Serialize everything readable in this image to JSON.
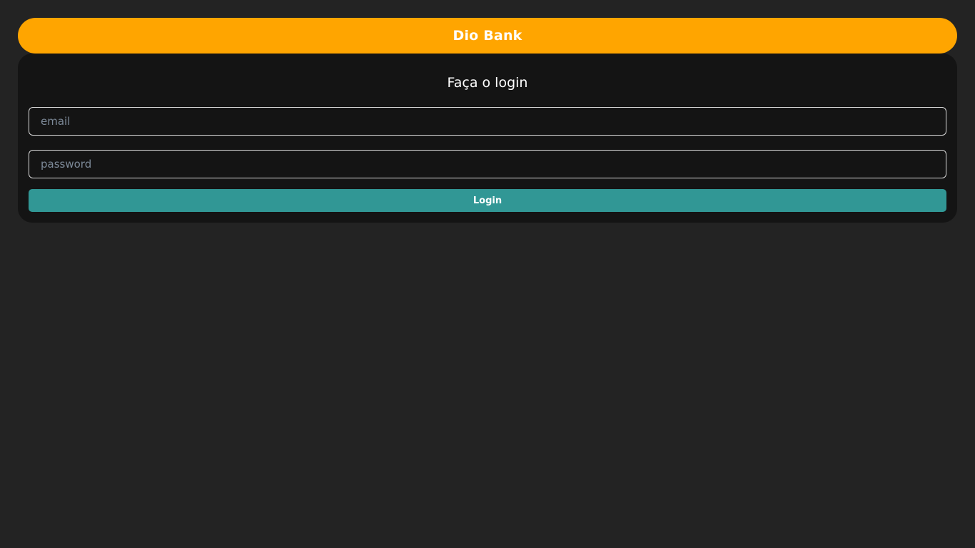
{
  "header": {
    "title": "Dio Bank"
  },
  "login": {
    "title": "Faça o login",
    "email": {
      "value": "",
      "placeholder": "email"
    },
    "password": {
      "value": "",
      "placeholder": "password"
    },
    "button_label": "Login"
  },
  "colors": {
    "background": "#232323",
    "header": "#FFA500",
    "card": "#141414",
    "button": "#319795",
    "placeholder": "#7d8a99"
  }
}
